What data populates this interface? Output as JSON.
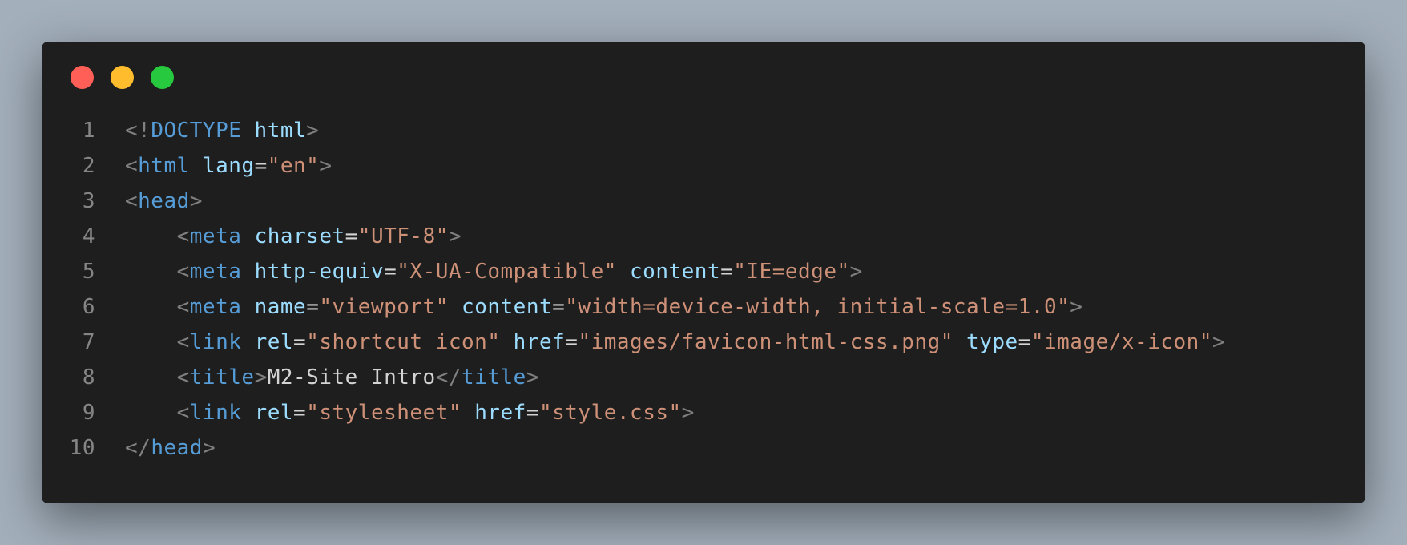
{
  "window": {
    "controls": [
      "close",
      "minimize",
      "maximize"
    ],
    "colors": {
      "close": "#ff5f56",
      "minimize": "#ffbd2e",
      "maximize": "#27c93f",
      "background": "#1e1e1e",
      "page_background": "#a3afbb"
    }
  },
  "code": {
    "lines": [
      {
        "n": "1",
        "tokens": [
          [
            "p",
            "<!"
          ],
          [
            "t",
            "DOCTYPE"
          ],
          [
            "x",
            " "
          ],
          [
            "a",
            "html"
          ],
          [
            "p",
            ">"
          ]
        ]
      },
      {
        "n": "2",
        "tokens": [
          [
            "p",
            "<"
          ],
          [
            "t",
            "html"
          ],
          [
            "x",
            " "
          ],
          [
            "a",
            "lang"
          ],
          [
            "e",
            "="
          ],
          [
            "s",
            "\"en\""
          ],
          [
            "p",
            ">"
          ]
        ]
      },
      {
        "n": "3",
        "tokens": [
          [
            "p",
            "<"
          ],
          [
            "t",
            "head"
          ],
          [
            "p",
            ">"
          ]
        ]
      },
      {
        "n": "4",
        "tokens": [
          [
            "x",
            "    "
          ],
          [
            "p",
            "<"
          ],
          [
            "t",
            "meta"
          ],
          [
            "x",
            " "
          ],
          [
            "a",
            "charset"
          ],
          [
            "e",
            "="
          ],
          [
            "s",
            "\"UTF-8\""
          ],
          [
            "p",
            ">"
          ]
        ]
      },
      {
        "n": "5",
        "tokens": [
          [
            "x",
            "    "
          ],
          [
            "p",
            "<"
          ],
          [
            "t",
            "meta"
          ],
          [
            "x",
            " "
          ],
          [
            "a",
            "http-equiv"
          ],
          [
            "e",
            "="
          ],
          [
            "s",
            "\"X-UA-Compatible\""
          ],
          [
            "x",
            " "
          ],
          [
            "a",
            "content"
          ],
          [
            "e",
            "="
          ],
          [
            "s",
            "\"IE=edge\""
          ],
          [
            "p",
            ">"
          ]
        ]
      },
      {
        "n": "6",
        "tokens": [
          [
            "x",
            "    "
          ],
          [
            "p",
            "<"
          ],
          [
            "t",
            "meta"
          ],
          [
            "x",
            " "
          ],
          [
            "a",
            "name"
          ],
          [
            "e",
            "="
          ],
          [
            "s",
            "\"viewport\""
          ],
          [
            "x",
            " "
          ],
          [
            "a",
            "content"
          ],
          [
            "e",
            "="
          ],
          [
            "s",
            "\"width=device-width, initial-scale=1.0\""
          ],
          [
            "p",
            ">"
          ]
        ]
      },
      {
        "n": "7",
        "tokens": [
          [
            "x",
            "    "
          ],
          [
            "p",
            "<"
          ],
          [
            "t",
            "link"
          ],
          [
            "x",
            " "
          ],
          [
            "a",
            "rel"
          ],
          [
            "e",
            "="
          ],
          [
            "s",
            "\"shortcut icon\""
          ],
          [
            "x",
            " "
          ],
          [
            "a",
            "href"
          ],
          [
            "e",
            "="
          ],
          [
            "s",
            "\"images/favicon-html-css.png\""
          ],
          [
            "x",
            " "
          ],
          [
            "a",
            "type"
          ],
          [
            "e",
            "="
          ],
          [
            "s",
            "\"image/x-icon\""
          ],
          [
            "p",
            ">"
          ]
        ]
      },
      {
        "n": "8",
        "tokens": [
          [
            "x",
            "    "
          ],
          [
            "p",
            "<"
          ],
          [
            "t",
            "title"
          ],
          [
            "p",
            ">"
          ],
          [
            "x",
            "M2-Site Intro"
          ],
          [
            "p",
            "</"
          ],
          [
            "t",
            "title"
          ],
          [
            "p",
            ">"
          ]
        ]
      },
      {
        "n": "9",
        "tokens": [
          [
            "x",
            "    "
          ],
          [
            "p",
            "<"
          ],
          [
            "t",
            "link"
          ],
          [
            "x",
            " "
          ],
          [
            "a",
            "rel"
          ],
          [
            "e",
            "="
          ],
          [
            "s",
            "\"stylesheet\""
          ],
          [
            "x",
            " "
          ],
          [
            "a",
            "href"
          ],
          [
            "e",
            "="
          ],
          [
            "s",
            "\"style.css\""
          ],
          [
            "p",
            ">"
          ]
        ]
      },
      {
        "n": "10",
        "tokens": [
          [
            "p",
            "</"
          ],
          [
            "t",
            "head"
          ],
          [
            "p",
            ">"
          ]
        ]
      }
    ]
  }
}
